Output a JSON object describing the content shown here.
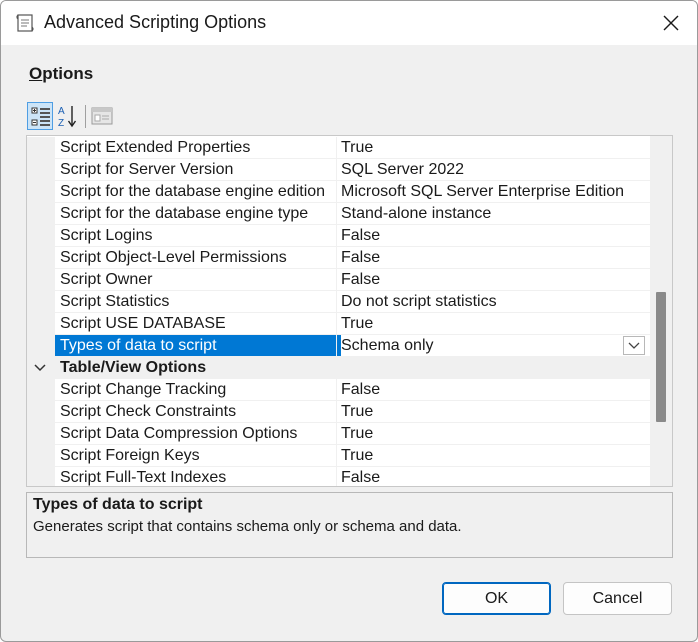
{
  "window": {
    "title": "Advanced Scripting Options"
  },
  "options_label": {
    "first_char": "O",
    "rest": "ptions"
  },
  "toolbar": {
    "buttons": [
      {
        "name": "categorized-view-icon",
        "active": true
      },
      {
        "name": "alphabetical-sort-icon",
        "active": false
      },
      {
        "name": "property-pages-icon",
        "active": false
      }
    ]
  },
  "grid": {
    "rows": [
      {
        "name": "Script Extended Properties",
        "value": "True"
      },
      {
        "name": "Script for Server Version",
        "value": "SQL Server 2022"
      },
      {
        "name": "Script for the database engine edition",
        "value": "Microsoft SQL Server Enterprise Edition"
      },
      {
        "name": "Script for the database engine type",
        "value": "Stand-alone instance"
      },
      {
        "name": "Script Logins",
        "value": "False"
      },
      {
        "name": "Script Object-Level Permissions",
        "value": "False"
      },
      {
        "name": "Script Owner",
        "value": "False"
      },
      {
        "name": "Script Statistics",
        "value": "Do not script statistics"
      },
      {
        "name": "Script USE DATABASE",
        "value": "True"
      },
      {
        "name": "Types of data to script",
        "value": "Schema only",
        "selected": true
      },
      {
        "category": "Table/View Options"
      },
      {
        "name": "Script Change Tracking",
        "value": "False"
      },
      {
        "name": "Script Check Constraints",
        "value": "True"
      },
      {
        "name": "Script Data Compression Options",
        "value": "True"
      },
      {
        "name": "Script Foreign Keys",
        "value": "True"
      },
      {
        "name": "Script Full-Text Indexes",
        "value": "False"
      }
    ]
  },
  "description": {
    "title": "Types of data to script",
    "body": "Generates script that contains schema only or schema and data."
  },
  "buttons": {
    "ok": "OK",
    "cancel": "Cancel"
  },
  "colors": {
    "selection": "#0078d4",
    "accent_border": "#0067c0"
  }
}
